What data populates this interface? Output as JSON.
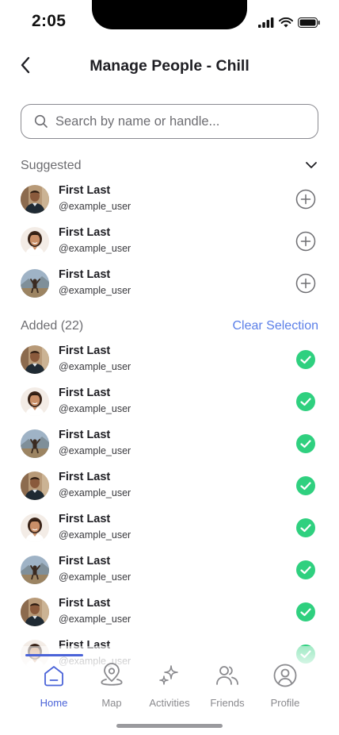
{
  "status_bar": {
    "time": "2:05"
  },
  "header": {
    "title": "Manage People - Chill",
    "back_icon": "chevron-left-icon"
  },
  "search": {
    "placeholder": "Search by name or handle...",
    "value": ""
  },
  "suggested": {
    "title": "Suggested",
    "people": [
      {
        "name": "First Last",
        "handle": "@example_user",
        "avatar": "man-portrait"
      },
      {
        "name": "First Last",
        "handle": "@example_user",
        "avatar": "woman-portrait"
      },
      {
        "name": "First Last",
        "handle": "@example_user",
        "avatar": "mountain-portrait"
      }
    ]
  },
  "added": {
    "title": "Added (22)",
    "clear_label": "Clear Selection",
    "people": [
      {
        "name": "First Last",
        "handle": "@example_user",
        "avatar": "man-portrait"
      },
      {
        "name": "First Last",
        "handle": "@example_user",
        "avatar": "woman-portrait"
      },
      {
        "name": "First Last",
        "handle": "@example_user",
        "avatar": "mountain-portrait"
      },
      {
        "name": "First Last",
        "handle": "@example_user",
        "avatar": "man-portrait"
      },
      {
        "name": "First Last",
        "handle": "@example_user",
        "avatar": "woman-portrait"
      },
      {
        "name": "First Last",
        "handle": "@example_user",
        "avatar": "mountain-portrait"
      },
      {
        "name": "First Last",
        "handle": "@example_user",
        "avatar": "man-portrait"
      },
      {
        "name": "First Last",
        "handle": "@example_user",
        "avatar": "woman-portrait"
      }
    ]
  },
  "nav": {
    "items": [
      {
        "label": "Home",
        "icon": "home-icon",
        "active": true
      },
      {
        "label": "Map",
        "icon": "map-pin-icon",
        "active": false
      },
      {
        "label": "Activities",
        "icon": "sparkle-icon",
        "active": false
      },
      {
        "label": "Friends",
        "icon": "friends-icon",
        "active": false
      },
      {
        "label": "Profile",
        "icon": "profile-icon",
        "active": false
      }
    ]
  },
  "colors": {
    "accent": "#4a63d8",
    "link": "#5b7fe8",
    "check": "#2fd07f"
  }
}
